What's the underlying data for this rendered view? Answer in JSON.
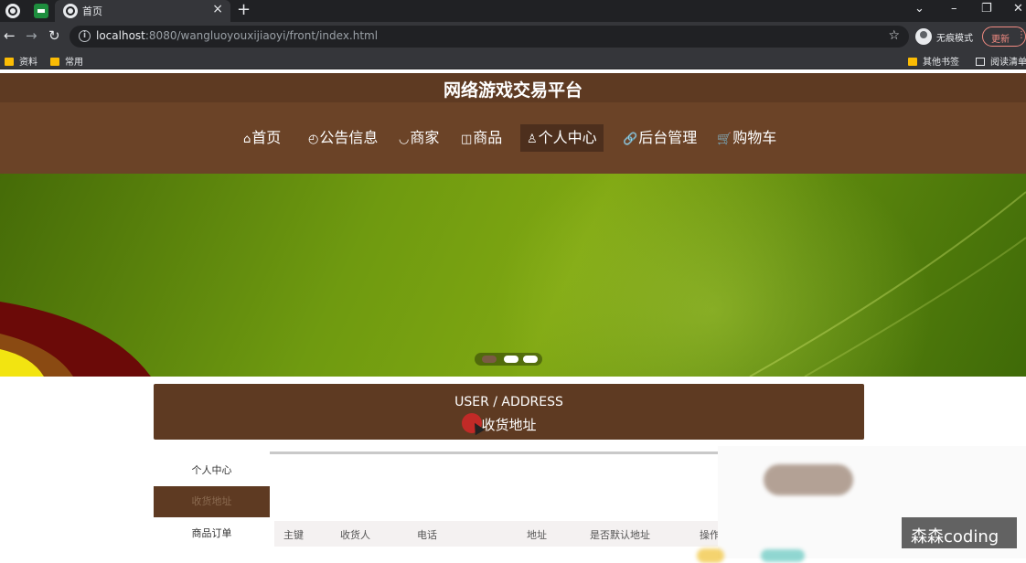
{
  "browser": {
    "tab_title": "首页",
    "url_host": "localhost",
    "url_path": ":8080/wangluoyouxijiaoyi/front/index.html",
    "profile_label": "无痕模式",
    "update_label": "更新",
    "bookmarks": [
      "资料",
      "常用"
    ],
    "bookmarks_right": [
      "其他书签",
      "阅读清单"
    ]
  },
  "site": {
    "title": "网络游戏交易平台",
    "nav": [
      {
        "icon": "⌂",
        "label": "首页"
      },
      {
        "icon": "◴",
        "label": "公告信息"
      },
      {
        "icon": "◡",
        "label": "商家"
      },
      {
        "icon": "◫",
        "label": "商品"
      },
      {
        "icon": "♙",
        "label": "个人中心",
        "active": true
      },
      {
        "icon": "🔗",
        "label": "后台管理"
      },
      {
        "icon": "🛒",
        "label": "购物车"
      }
    ],
    "colors": {
      "brand": "#6b4327",
      "brand_dark": "#5e3a22",
      "active_nav": "#4d2f1d"
    }
  },
  "carousel": {
    "active_index": 0,
    "count": 3
  },
  "section": {
    "title_en": "USER / ADDRESS",
    "title_cn": "收货地址"
  },
  "side_menu": [
    {
      "label": "个人中心"
    },
    {
      "label": "收货地址",
      "active": true
    },
    {
      "label": "商品订单"
    }
  ],
  "table": {
    "headers": [
      "主键",
      "收货人",
      "电话",
      "地址",
      "是否默认地址",
      "操作"
    ]
  },
  "watermark": "森森coding"
}
